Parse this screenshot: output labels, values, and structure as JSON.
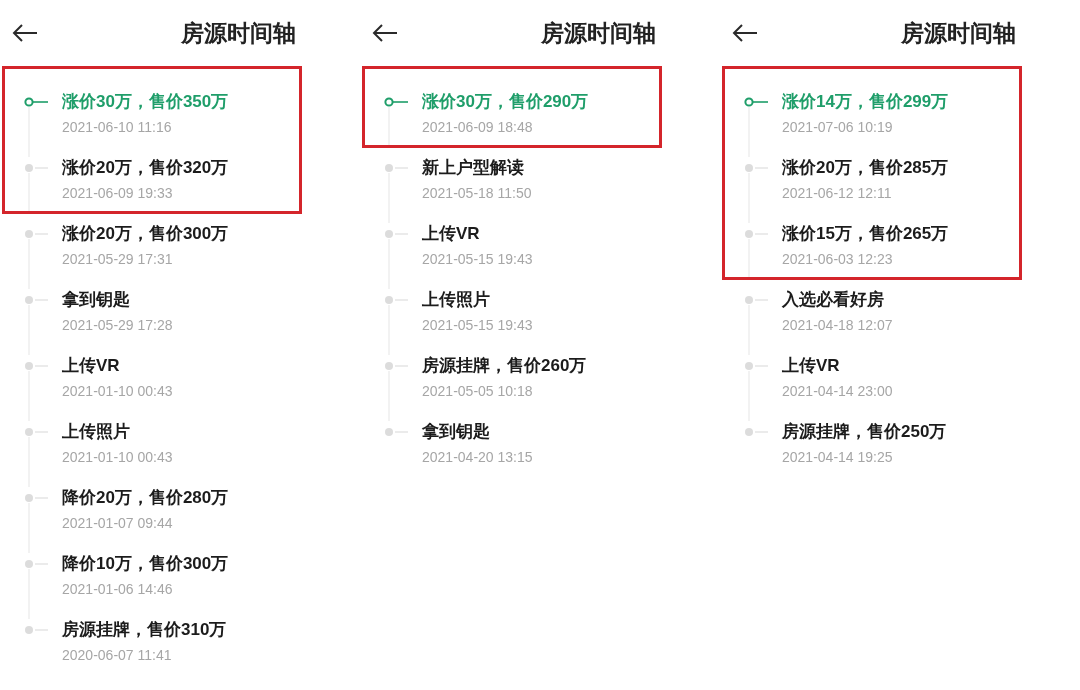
{
  "panels": [
    {
      "title": "房源时间轴",
      "events": [
        {
          "label": "涨价30万，售价350万",
          "time": "2021-06-10 11:16",
          "active": true,
          "highlighted": true
        },
        {
          "label": "涨价20万，售价320万",
          "time": "2021-06-09 19:33",
          "active": false,
          "highlighted": true
        },
        {
          "label": "涨价20万，售价300万",
          "time": "2021-05-29 17:31",
          "active": false,
          "highlighted": false
        },
        {
          "label": "拿到钥匙",
          "time": "2021-05-29 17:28",
          "active": false,
          "highlighted": false
        },
        {
          "label": "上传VR",
          "time": "2021-01-10 00:43",
          "active": false,
          "highlighted": false
        },
        {
          "label": "上传照片",
          "time": "2021-01-10 00:43",
          "active": false,
          "highlighted": false
        },
        {
          "label": "降价20万，售价280万",
          "time": "2021-01-07 09:44",
          "active": false,
          "highlighted": false
        },
        {
          "label": "降价10万，售价300万",
          "time": "2021-01-06 14:46",
          "active": false,
          "highlighted": false
        },
        {
          "label": "房源挂牌，售价310万",
          "time": "2020-06-07 11:41",
          "active": false,
          "highlighted": false
        }
      ]
    },
    {
      "title": "房源时间轴",
      "events": [
        {
          "label": "涨价30万，售价290万",
          "time": "2021-06-09 18:48",
          "active": true,
          "highlighted": true
        },
        {
          "label": "新上户型解读",
          "time": "2021-05-18 11:50",
          "active": false,
          "highlighted": false
        },
        {
          "label": "上传VR",
          "time": "2021-05-15 19:43",
          "active": false,
          "highlighted": false
        },
        {
          "label": "上传照片",
          "time": "2021-05-15 19:43",
          "active": false,
          "highlighted": false
        },
        {
          "label": "房源挂牌，售价260万",
          "time": "2021-05-05 10:18",
          "active": false,
          "highlighted": false
        },
        {
          "label": "拿到钥匙",
          "time": "2021-04-20 13:15",
          "active": false,
          "highlighted": false
        }
      ]
    },
    {
      "title": "房源时间轴",
      "events": [
        {
          "label": "涨价14万，售价299万",
          "time": "2021-07-06 10:19",
          "active": true,
          "highlighted": true
        },
        {
          "label": "涨价20万，售价285万",
          "time": "2021-06-12 12:11",
          "active": false,
          "highlighted": true
        },
        {
          "label": "涨价15万，售价265万",
          "time": "2021-06-03 12:23",
          "active": false,
          "highlighted": true
        },
        {
          "label": "入选必看好房",
          "time": "2021-04-18 12:07",
          "active": false,
          "highlighted": false
        },
        {
          "label": "上传VR",
          "time": "2021-04-14 23:00",
          "active": false,
          "highlighted": false
        },
        {
          "label": "房源挂牌，售价250万",
          "time": "2021-04-14 19:25",
          "active": false,
          "highlighted": false
        }
      ]
    }
  ]
}
